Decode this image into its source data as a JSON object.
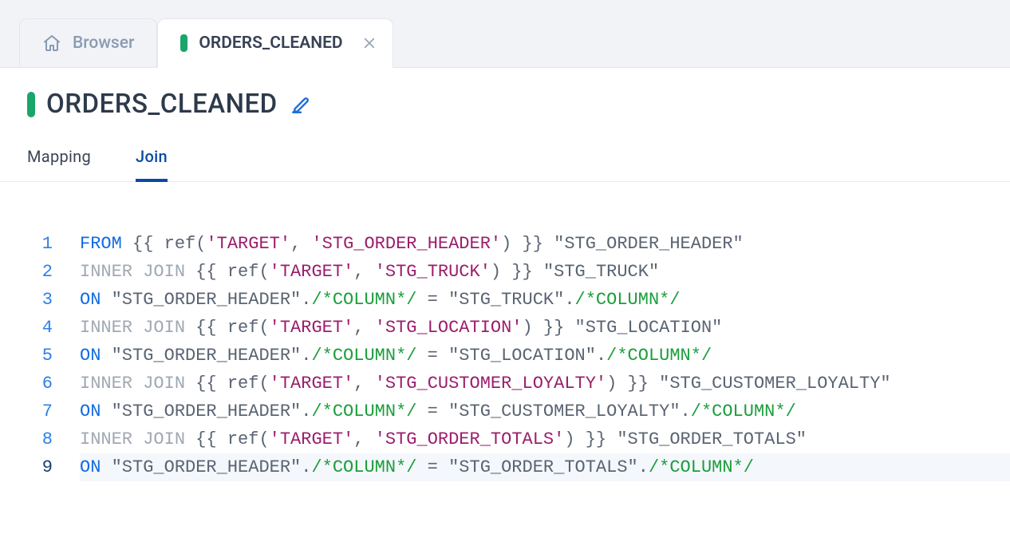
{
  "tabs": {
    "browser_label": "Browser",
    "active_label": "ORDERS_CLEANED"
  },
  "title": "ORDERS_CLEANED",
  "subtabs": {
    "mapping": "Mapping",
    "join": "Join"
  },
  "code_lines": [
    {
      "n": "1",
      "tokens": [
        {
          "c": "kw-blue",
          "t": "FROM"
        },
        {
          "c": "plain",
          "t": " {{ ref("
        },
        {
          "c": "str",
          "t": "'TARGET'"
        },
        {
          "c": "plain",
          "t": ", "
        },
        {
          "c": "str",
          "t": "'STG_ORDER_HEADER'"
        },
        {
          "c": "plain",
          "t": ") }} "
        },
        {
          "c": "quoted",
          "t": "\"STG_ORDER_HEADER\""
        }
      ]
    },
    {
      "n": "2",
      "tokens": [
        {
          "c": "kw-gray",
          "t": "INNER JOIN"
        },
        {
          "c": "plain",
          "t": " {{ ref("
        },
        {
          "c": "str",
          "t": "'TARGET'"
        },
        {
          "c": "plain",
          "t": ", "
        },
        {
          "c": "str",
          "t": "'STG_TRUCK'"
        },
        {
          "c": "plain",
          "t": ") }} "
        },
        {
          "c": "quoted",
          "t": "\"STG_TRUCK\""
        }
      ]
    },
    {
      "n": "3",
      "tokens": [
        {
          "c": "kw-blue",
          "t": "ON"
        },
        {
          "c": "plain",
          "t": " "
        },
        {
          "c": "quoted",
          "t": "\"STG_ORDER_HEADER\""
        },
        {
          "c": "dot-op",
          "t": "."
        },
        {
          "c": "comment",
          "t": "/*COLUMN*/"
        },
        {
          "c": "plain",
          "t": " = "
        },
        {
          "c": "quoted",
          "t": "\"STG_TRUCK\""
        },
        {
          "c": "dot-op",
          "t": "."
        },
        {
          "c": "comment",
          "t": "/*COLUMN*/"
        }
      ]
    },
    {
      "n": "4",
      "tokens": [
        {
          "c": "kw-gray",
          "t": "INNER JOIN"
        },
        {
          "c": "plain",
          "t": " {{ ref("
        },
        {
          "c": "str",
          "t": "'TARGET'"
        },
        {
          "c": "plain",
          "t": ", "
        },
        {
          "c": "str",
          "t": "'STG_LOCATION'"
        },
        {
          "c": "plain",
          "t": ") }} "
        },
        {
          "c": "quoted",
          "t": "\"STG_LOCATION\""
        }
      ]
    },
    {
      "n": "5",
      "tokens": [
        {
          "c": "kw-blue",
          "t": "ON"
        },
        {
          "c": "plain",
          "t": " "
        },
        {
          "c": "quoted",
          "t": "\"STG_ORDER_HEADER\""
        },
        {
          "c": "dot-op",
          "t": "."
        },
        {
          "c": "comment",
          "t": "/*COLUMN*/"
        },
        {
          "c": "plain",
          "t": " = "
        },
        {
          "c": "quoted",
          "t": "\"STG_LOCATION\""
        },
        {
          "c": "dot-op",
          "t": "."
        },
        {
          "c": "comment",
          "t": "/*COLUMN*/"
        }
      ]
    },
    {
      "n": "6",
      "tokens": [
        {
          "c": "kw-gray",
          "t": "INNER JOIN"
        },
        {
          "c": "plain",
          "t": " {{ ref("
        },
        {
          "c": "str",
          "t": "'TARGET'"
        },
        {
          "c": "plain",
          "t": ", "
        },
        {
          "c": "str",
          "t": "'STG_CUSTOMER_LOYALTY'"
        },
        {
          "c": "plain",
          "t": ") }} "
        },
        {
          "c": "quoted",
          "t": "\"STG_CUSTOMER_LOYALTY\""
        }
      ]
    },
    {
      "n": "7",
      "tokens": [
        {
          "c": "kw-blue",
          "t": "ON"
        },
        {
          "c": "plain",
          "t": " "
        },
        {
          "c": "quoted",
          "t": "\"STG_ORDER_HEADER\""
        },
        {
          "c": "dot-op",
          "t": "."
        },
        {
          "c": "comment",
          "t": "/*COLUMN*/"
        },
        {
          "c": "plain",
          "t": " = "
        },
        {
          "c": "quoted",
          "t": "\"STG_CUSTOMER_LOYALTY\""
        },
        {
          "c": "dot-op",
          "t": "."
        },
        {
          "c": "comment",
          "t": "/*COLUMN*/"
        }
      ]
    },
    {
      "n": "8",
      "tokens": [
        {
          "c": "kw-gray",
          "t": "INNER JOIN"
        },
        {
          "c": "plain",
          "t": " {{ ref("
        },
        {
          "c": "str",
          "t": "'TARGET'"
        },
        {
          "c": "plain",
          "t": ", "
        },
        {
          "c": "str",
          "t": "'STG_ORDER_TOTALS'"
        },
        {
          "c": "plain",
          "t": ") }} "
        },
        {
          "c": "quoted",
          "t": "\"STG_ORDER_TOTALS\""
        }
      ]
    },
    {
      "n": "9",
      "current": true,
      "tokens": [
        {
          "c": "kw-blue",
          "t": "ON"
        },
        {
          "c": "plain",
          "t": " "
        },
        {
          "c": "quoted",
          "t": "\"STG_ORDER_HEADER\""
        },
        {
          "c": "dot-op",
          "t": "."
        },
        {
          "c": "comment",
          "t": "/*COLUMN*/"
        },
        {
          "c": "plain",
          "t": " = "
        },
        {
          "c": "quoted",
          "t": "\"STG_ORDER_TOTALS\""
        },
        {
          "c": "dot-op",
          "t": "."
        },
        {
          "c": "comment",
          "t": "/*COLUMN*/"
        }
      ]
    }
  ]
}
